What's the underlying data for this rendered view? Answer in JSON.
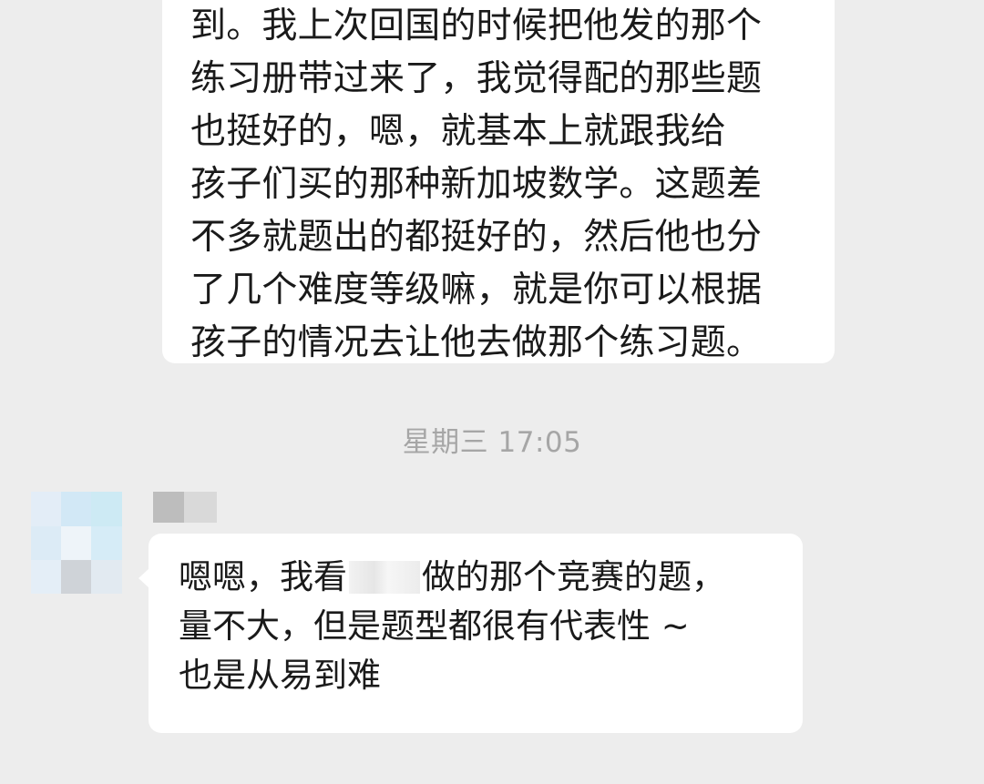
{
  "messages": [
    {
      "lines": [
        "到。我上次回国的时候把他发的那个",
        "练习册带过来了，我觉得配的那些题",
        "也挺好的，嗯，就基本上就跟我给",
        "孩子们买的那种新加坡数学。这题差",
        "不多就题出的都挺好的，然后他也分",
        "了几个难度等级嘛，就是你可以根据",
        "孩子的情况去让他去做那个练习题。"
      ]
    },
    {
      "line1_before": "嗯嗯，我看",
      "line1_after": "做的那个竞赛的题，",
      "line2": "量不大，但是题型都很有代表性 ~",
      "line3": "也是从易到难"
    }
  ],
  "timestamp": "星期三 17:05",
  "colors": {
    "background": "#ededed",
    "bubble": "#ffffff",
    "timestamp_text": "#a6a6a6"
  }
}
